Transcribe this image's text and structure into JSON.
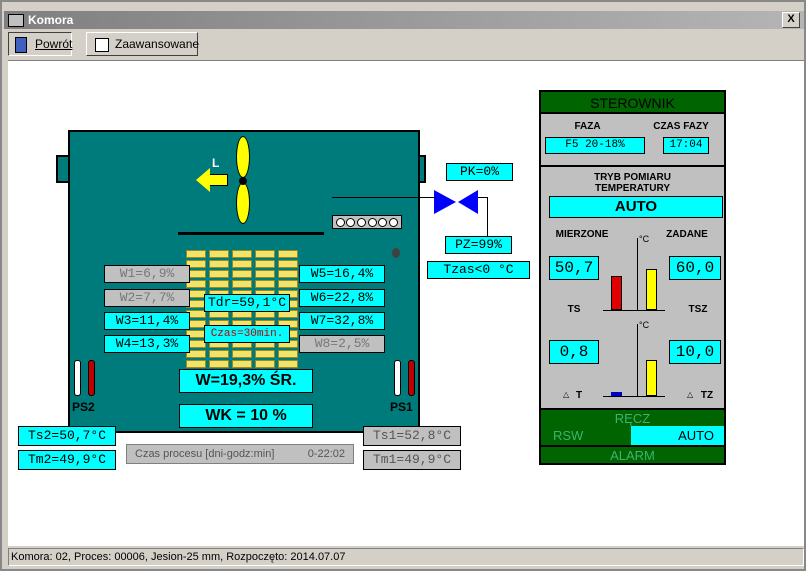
{
  "window": {
    "title": "Komora",
    "close_label": "X"
  },
  "toolbar": {
    "back_label": "Powrót",
    "advanced_label": "Zaawansowane"
  },
  "chamber": {
    "fan_direction": "L",
    "pk": "PK=0%",
    "pz": "PZ=99%",
    "tzas": "Tzas<0 °C",
    "tdr": "Tdr=59,1°C",
    "czas": "Czas=30min.",
    "w_left": [
      "W1=6,9%",
      "W2=7,7%",
      "W3=11,4%",
      "W4=13,3%"
    ],
    "w_right": [
      "W5=16,4%",
      "W6=22,8%",
      "W7=32,8%",
      "W8=2,5%"
    ],
    "w_avg": "W=19,3% ŚR.",
    "wk": "WK = 10 %",
    "ps2": "PS2",
    "ps1": "PS1",
    "ts2": "Ts2=50,7°C",
    "tm2": "Tm2=49,9°C",
    "ts1": "Ts1=52,8°C",
    "tm1": "Tm1=49,9°C",
    "process_label": "Czas procesu [dni-godz:min]",
    "process_value": "0-22:02"
  },
  "controller": {
    "title": "STEROWNIK",
    "faza_label": "FAZA",
    "faza_value": "F5 20-18%",
    "czas_fazy_label": "CZAS FAZY",
    "czas_fazy_value": "17:04",
    "tryb_label_1": "TRYB POMIARU",
    "tryb_label_2": "TEMPERATURY",
    "tryb_value": "AUTO",
    "mierzone": "MIERZONE",
    "zadane": "ZADANE",
    "ts_value": "50,7",
    "tsz_value": "60,0",
    "ts_label": "TS",
    "tsz_label": "TSZ",
    "deg_unit": "°C",
    "dt_value": "0,8",
    "dtz_value": "10,0",
    "dt_label": "T",
    "dtz_label": "TZ",
    "recz": "RĘCZ",
    "rsw": "RSW",
    "auto": "AUTO",
    "alarm": "ALARM",
    "colors": {
      "dark_green": "#006400",
      "cyan": "#00ffff",
      "red": "#e00000",
      "yellow": "#ffff00"
    }
  },
  "status": {
    "text": "Komora: 02,  Proces: 00006,  Jesion-25 mm,  Rozpoczęto: 2014.07.07"
  }
}
